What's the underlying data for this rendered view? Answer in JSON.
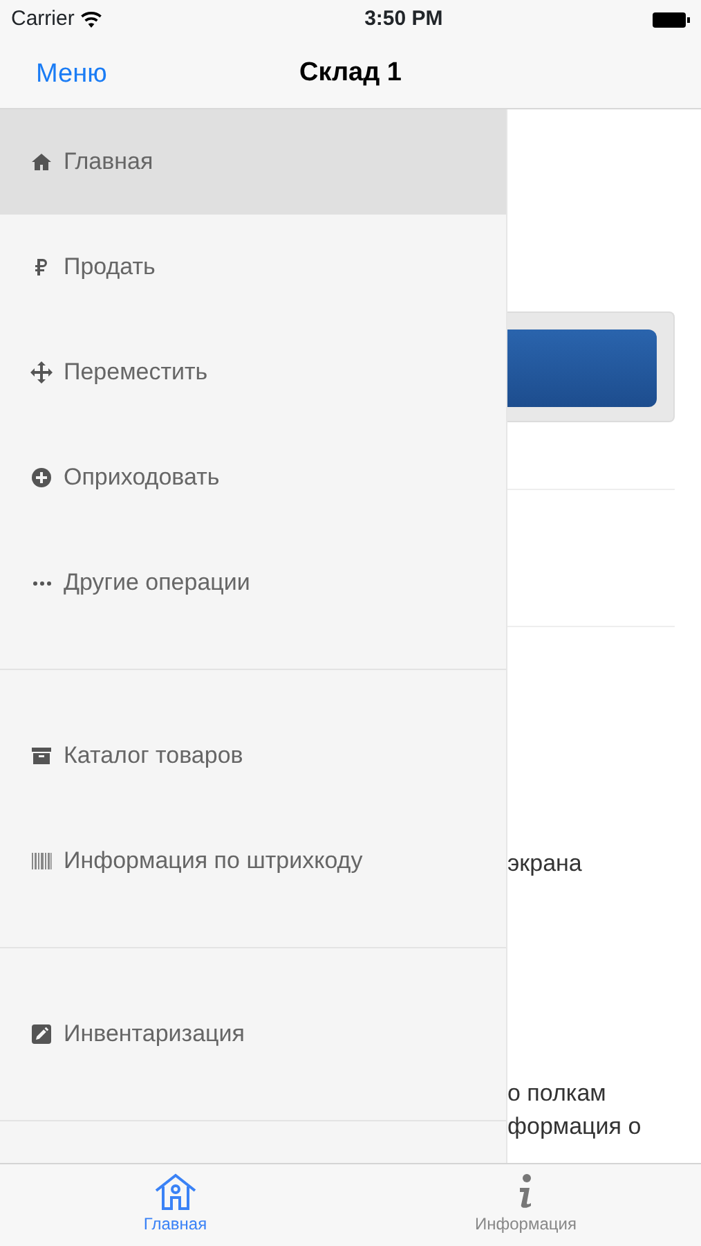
{
  "status_bar": {
    "carrier": "Carrier",
    "time": "3:50 PM"
  },
  "nav_bar": {
    "back": "Меню",
    "title": "Склад 1"
  },
  "menu": {
    "sections": [
      {
        "items": [
          {
            "label": "Главная",
            "selected": true
          },
          {
            "label": "Продать",
            "selected": false
          },
          {
            "label": "Переместить",
            "selected": false
          },
          {
            "label": "Оприходовать",
            "selected": false
          },
          {
            "label": "Другие операции",
            "selected": false
          }
        ]
      },
      {
        "items": [
          {
            "label": "Каталог товаров",
            "selected": false
          },
          {
            "label": "Информация по штрихкоду",
            "selected": false
          }
        ]
      },
      {
        "items": [
          {
            "label": "Инвентаризация",
            "selected": false
          }
        ]
      }
    ]
  },
  "content": {
    "texts": [
      "экрана",
      "о полкам",
      "формация о"
    ]
  },
  "tab_bar": [
    {
      "label": "Главная",
      "selected": true
    },
    {
      "label": "Информация",
      "selected": false
    }
  ]
}
